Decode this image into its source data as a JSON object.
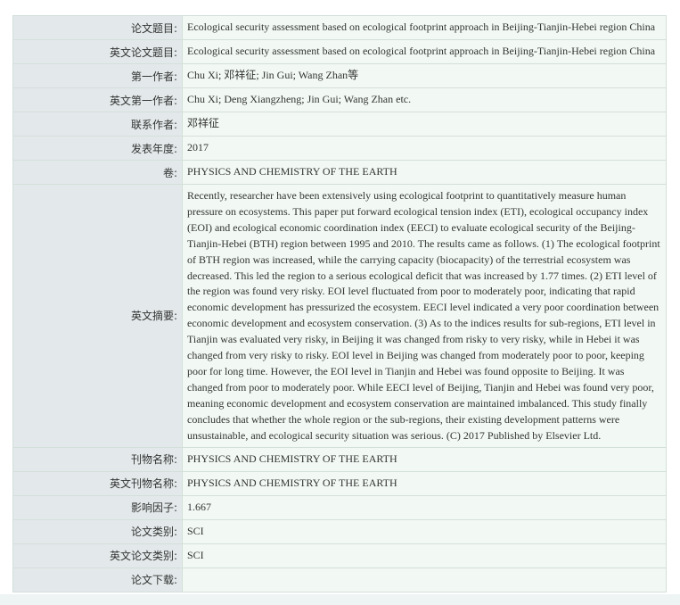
{
  "rows": [
    {
      "key": "title",
      "label": "论文题目:",
      "value": "Ecological security assessment based on ecological footprint approach in Beijing-Tianjin-Hebei region China"
    },
    {
      "key": "english-title",
      "label": "英文论文题目:",
      "value": "Ecological security assessment based on ecological footprint approach in Beijing-Tianjin-Hebei region China"
    },
    {
      "key": "first-author",
      "label": "第一作者:",
      "value": "Chu Xi; 邓祥征; Jin Gui; Wang Zhan等"
    },
    {
      "key": "english-first-author",
      "label": "英文第一作者:",
      "value": "Chu Xi; Deng Xiangzheng; Jin Gui; Wang Zhan etc."
    },
    {
      "key": "corresponding-author",
      "label": "联系作者:",
      "value": "邓祥征"
    },
    {
      "key": "publication-year",
      "label": "发表年度:",
      "value": "2017"
    },
    {
      "key": "volume",
      "label": "卷:",
      "value": "PHYSICS AND CHEMISTRY OF THE EARTH"
    },
    {
      "key": "english-abstract",
      "label": "英文摘要:",
      "value": "Recently, researcher have been extensively using ecological footprint to quantitatively measure human pressure on ecosystems. This paper put forward ecological tension index (ETI), ecological occupancy index (EOI) and ecological economic coordination index (EECI) to evaluate ecological security of the Beijing-Tianjin-Hebei (BTH) region between 1995 and 2010. The results came as follows. (1) The ecological footprint of BTH region was increased, while the carrying capacity (biocapacity) of the terrestrial ecosystem was decreased. This led the region to a serious ecological deficit that was increased by 1.77 times. (2) ETI level of the region was found very risky. EOI level fluctuated from poor to moderately poor, indicating that rapid economic development has pressurized the ecosystem. EECI level indicated a very poor coordination between economic development and ecosystem conservation. (3) As to the indices results for sub-regions, ETI level in Tianjin was evaluated very risky, in Beijing it was changed from risky to very risky, while in Hebei it was changed from very risky to risky. EOI level in Beijing was changed from moderately poor to poor, keeping poor for long time. However, the EOI level in Tianjin and Hebei was found opposite to Beijing. It was changed from poor to moderately poor. While EECI level of Beijing, Tianjin and Hebei was found very poor, meaning economic development and ecosystem conservation are maintained imbalanced. This study finally concludes that whether the whole region or the sub-regions, their existing development patterns were unsustainable, and ecological security situation was serious. (C) 2017 Published by Elsevier Ltd."
    },
    {
      "key": "journal-name",
      "label": "刊物名称:",
      "value": "PHYSICS AND CHEMISTRY OF THE EARTH"
    },
    {
      "key": "english-journal-name",
      "label": "英文刊物名称:",
      "value": "PHYSICS AND CHEMISTRY OF THE EARTH"
    },
    {
      "key": "impact-factor",
      "label": "影响因子:",
      "value": "1.667"
    },
    {
      "key": "paper-category",
      "label": "论文类别:",
      "value": "SCI"
    },
    {
      "key": "english-paper-category",
      "label": "英文论文类别:",
      "value": "SCI"
    },
    {
      "key": "paper-download",
      "label": "论文下载:",
      "value": ""
    }
  ]
}
